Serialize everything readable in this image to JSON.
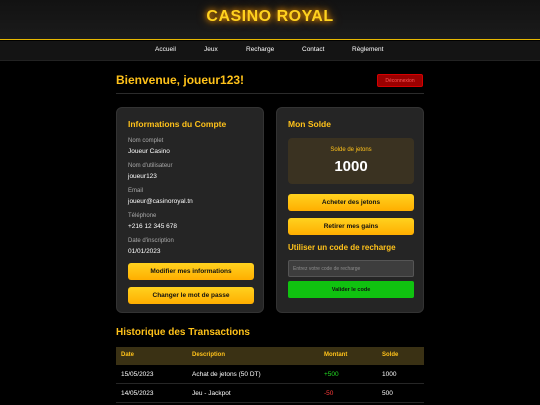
{
  "header": {
    "logo": "CASINO ROYAL"
  },
  "nav": {
    "items": [
      "Accueil",
      "Jeux",
      "Recharge",
      "Contact",
      "Règlement"
    ]
  },
  "welcome": {
    "title": "Bienvenue, joueur123!",
    "logout_label": "Déconnexion"
  },
  "account": {
    "title": "Informations du Compte",
    "fields": [
      {
        "label": "Nom complet",
        "value": "Joueur Casino"
      },
      {
        "label": "Nom d'utilisateur",
        "value": "joueur123"
      },
      {
        "label": "Email",
        "value": "joueur@casinoroyal.tn"
      },
      {
        "label": "Téléphone",
        "value": "+216 12 345 678"
      },
      {
        "label": "Date d'inscription",
        "value": "01/01/2023"
      }
    ],
    "edit_label": "Modifier mes informations",
    "password_label": "Changer le mot de passe"
  },
  "balance": {
    "title": "Mon Solde",
    "box_label": "Solde de jetons",
    "amount": "1000",
    "buy_label": "Acheter des jetons",
    "withdraw_label": "Retirer mes gains",
    "recharge_title": "Utiliser un code de recharge",
    "recharge_placeholder": "Entrez votre code de recharge",
    "validate_label": "Valider le code"
  },
  "history": {
    "title": "Historique des Transactions",
    "columns": [
      "Date",
      "Description",
      "Montant",
      "Solde"
    ],
    "rows": [
      {
        "date": "15/05/2023",
        "description": "Achat de jetons (50 DT)",
        "amount": "+500",
        "balance": "1000"
      },
      {
        "date": "14/05/2023",
        "description": "Jeu - Jackpot",
        "amount": "-50",
        "balance": "500"
      }
    ]
  },
  "colors": {
    "gold": "#ffc21a",
    "positive": "#22dd22",
    "negative": "#ff3a3a",
    "validate": "#10c210"
  }
}
